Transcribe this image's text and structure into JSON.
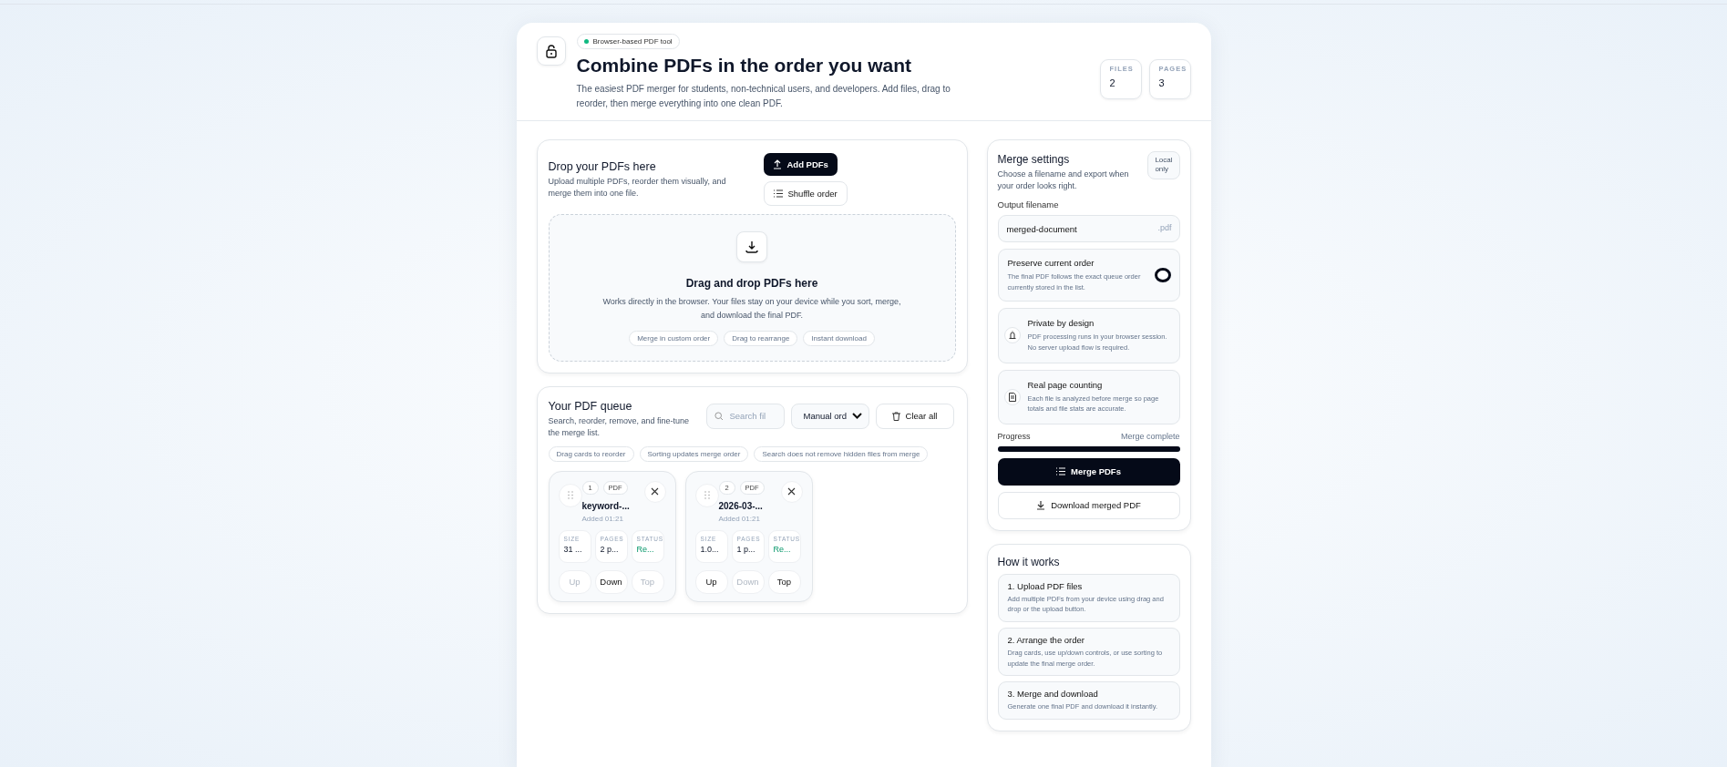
{
  "header": {
    "badge": "Browser-based PDF tool",
    "title": "Combine PDFs in the order you want",
    "description": "The easiest PDF merger for students, non-technical users, and developers. Add files, drag to reorder, then merge everything into one clean PDF.",
    "stats": [
      {
        "label": "FILES",
        "value": "2"
      },
      {
        "label": "PAGES",
        "value": "3"
      }
    ]
  },
  "upload": {
    "title": "Drop your PDFs here",
    "description": "Upload multiple PDFs, reorder them visually, and merge them into one file.",
    "add_button": "Add PDFs",
    "shuffle_button": "Shuffle order",
    "dropzone": {
      "title": "Drag and drop PDFs here",
      "description": "Works directly in the browser. Your files stay on your device while you sort, merge, and download the final PDF.",
      "chips": [
        "Merge in custom order",
        "Drag to rearrange",
        "Instant download"
      ]
    }
  },
  "queue": {
    "title": "Your PDF queue",
    "description": "Search, reorder, remove, and fine-tune the merge list.",
    "search": {
      "placeholder": "Search fil"
    },
    "sort": {
      "value": "Manual ord"
    },
    "clear_button": "Clear all",
    "chips": [
      "Drag cards to reorder",
      "Sorting updates merge order",
      "Search does not remove hidden files from merge"
    ],
    "files": [
      {
        "index": "1",
        "type": "PDF",
        "name": "keyword-...",
        "added": "Added 01:21",
        "stats": [
          {
            "kind": "size",
            "label": "SIZE",
            "value": "31 ..."
          },
          {
            "kind": "pages",
            "label": "PAGES",
            "value": "2 p..."
          },
          {
            "kind": "status",
            "label": "STATUS",
            "value": "Re..."
          }
        ],
        "actions": [
          {
            "label": "Up",
            "disabled": true
          },
          {
            "label": "Down",
            "disabled": false
          },
          {
            "label": "Top",
            "disabled": true
          }
        ]
      },
      {
        "index": "2",
        "type": "PDF",
        "name": "2026-03-...",
        "added": "Added 01:21",
        "stats": [
          {
            "kind": "size",
            "label": "SIZE",
            "value": "1.0..."
          },
          {
            "kind": "pages",
            "label": "PAGES",
            "value": "1 p..."
          },
          {
            "kind": "status",
            "label": "STATUS",
            "value": "Re..."
          }
        ],
        "actions": [
          {
            "label": "Up",
            "disabled": false
          },
          {
            "label": "Down",
            "disabled": true
          },
          {
            "label": "Top",
            "disabled": false
          }
        ]
      }
    ]
  },
  "settings": {
    "title": "Merge settings",
    "description": "Choose a filename and export when your order looks right.",
    "badge": "Local only",
    "output_label": "Output filename",
    "filename": "merged-document",
    "extension": ".pdf",
    "preserve": {
      "title": "Preserve current order",
      "description": "The final PDF follows the exact queue order currently stored in the list.",
      "on": true
    },
    "info": [
      {
        "kind": "lock",
        "title": "Private by design",
        "description": "PDF processing runs in your browser session. No server upload flow is required."
      },
      {
        "kind": "document",
        "title": "Real page counting",
        "description": "Each file is analyzed before merge so page totals and file stats are accurate."
      }
    ],
    "progress": {
      "label": "Progress",
      "status": "Merge complete",
      "level": 1
    },
    "merge_button": "Merge PDFs",
    "download_button": "Download merged PDF"
  },
  "how": {
    "title": "How it works",
    "steps": [
      {
        "title": "1. Upload PDF files",
        "description": "Add multiple PDFs from your device using drag and drop or the upload button."
      },
      {
        "title": "2. Arrange the order",
        "description": "Drag cards, use up/down controls, or use sorting to update the final merge order."
      },
      {
        "title": "3. Merge and download",
        "description": "Generate one final PDF and download it instantly."
      }
    ]
  }
}
